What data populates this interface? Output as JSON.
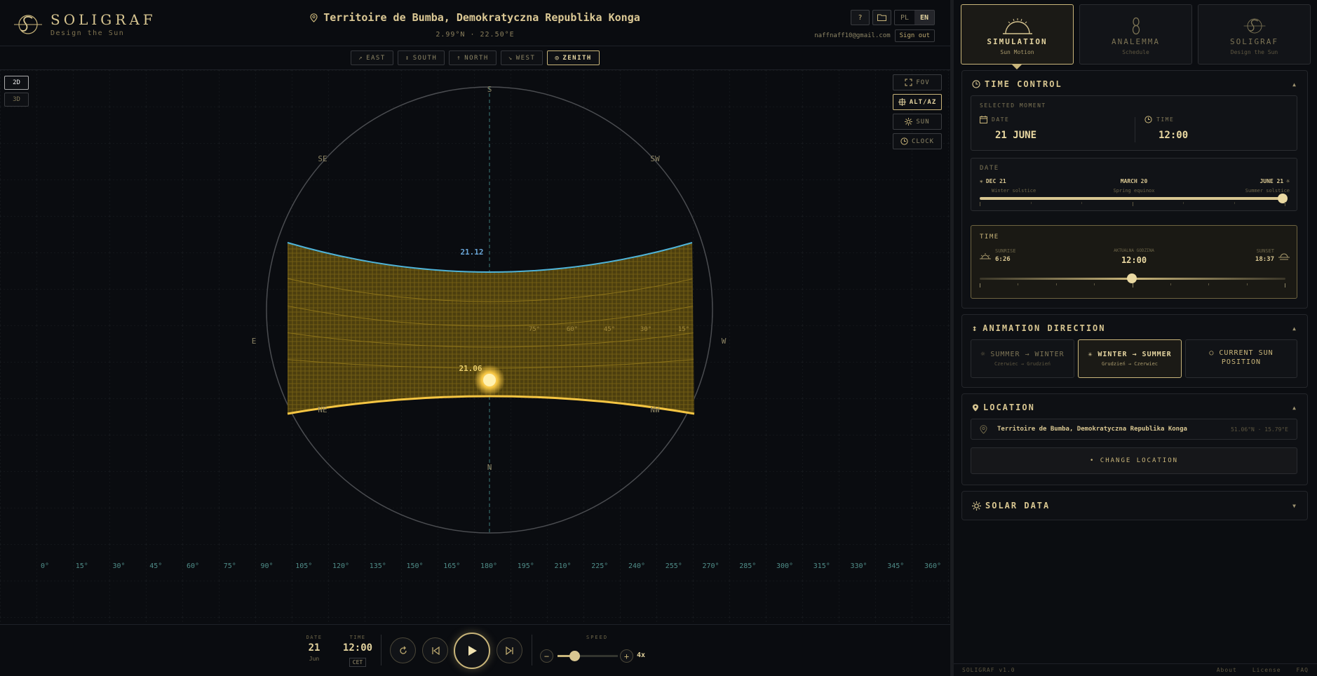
{
  "header": {
    "brand": "SOLIGRAF",
    "tagline": "Design the Sun",
    "location_title": "Territoire de Bumba, Demokratyczna Republika Konga",
    "location_coords": "2.99°N · 22.50°E",
    "help_label": "?",
    "lang_pl": "PL",
    "lang_en": "EN",
    "user_email": "naffnaff10@gmail.com",
    "signout_label": "Sign out"
  },
  "view_tabs": [
    {
      "label": "EAST",
      "glyph": "↗",
      "active": false
    },
    {
      "label": "SOUTH",
      "glyph": "↕",
      "active": false
    },
    {
      "label": "NORTH",
      "glyph": "↑",
      "active": false
    },
    {
      "label": "WEST",
      "glyph": "↘",
      "active": false
    },
    {
      "label": "ZENITH",
      "glyph": "◎",
      "active": true
    }
  ],
  "mode_buttons": {
    "d2": "2D",
    "d3": "3D"
  },
  "tools": {
    "fov": "FOV",
    "altaz": "ALT/AZ",
    "sun": "SUN",
    "clock": "CLOCK"
  },
  "compass": {
    "S": "S",
    "SE": "SE",
    "SW": "SW",
    "E": "E",
    "W": "W",
    "NE": "NE",
    "NW": "NW",
    "N": "N"
  },
  "plot_labels": {
    "upper_curve": "21.12",
    "lower_curve": "21.06",
    "alt_75": "75°",
    "alt_60": "60°",
    "alt_45": "45°",
    "alt_30": "30°",
    "alt_15": "15°"
  },
  "azimuth_ticks": [
    "0°",
    "15°",
    "30°",
    "45°",
    "60°",
    "75°",
    "90°",
    "105°",
    "120°",
    "135°",
    "150°",
    "165°",
    "180°",
    "195°",
    "210°",
    "225°",
    "240°",
    "255°",
    "270°",
    "285°",
    "300°",
    "315°",
    "330°",
    "345°",
    "360°"
  ],
  "playback": {
    "date_label": "DATE",
    "date_day": "21",
    "date_month": "Jun",
    "time_label": "TIME",
    "time_value": "12:00",
    "tz": "CET",
    "speed_label": "SPEED",
    "speed_value": "4x"
  },
  "panel_tabs": [
    {
      "title": "SIMULATION",
      "sub": "Sun Motion",
      "icon": "sunrise-icon",
      "active": true
    },
    {
      "title": "ANALEMMA",
      "sub": "Schedule",
      "icon": "figure-eight-icon",
      "active": false
    },
    {
      "title": "SOLIGRAF",
      "sub": "Design the Sun",
      "icon": "soligraf-logo-icon",
      "active": false
    }
  ],
  "time_control": {
    "heading": "TIME CONTROL",
    "selected_moment": "SELECTED MOMENT",
    "date_label": "DATE",
    "date_value": "21 JUNE",
    "time_label": "TIME",
    "time_value": "12:00",
    "date_slider": {
      "label": "DATE",
      "left_title": "DEC 21",
      "left_sub": "Winter solstice",
      "mid_title": "MARCH 20",
      "mid_sub": "Spring equinox",
      "right_title": "JUNE 21",
      "right_sub": "Summer solstice",
      "position": 1.0
    },
    "time_slider": {
      "label": "TIME",
      "sunrise_label": "SUNRISE",
      "sunrise": "6:26",
      "current_label": "AKTUALNA GODZINA",
      "current": "12:00",
      "sunset_label": "SUNSET",
      "sunset": "18:37",
      "position": 0.5
    }
  },
  "animation": {
    "heading": "ANIMATION DIRECTION",
    "opt1_title": "SUMMER → WINTER",
    "opt1_sub": "Czerwiec → Grudzień",
    "opt2_title": "WINTER → SUMMER",
    "opt2_sub": "Grudzień → Czerwiec",
    "opt3_title": "CURRENT SUN POSITION"
  },
  "location": {
    "heading": "LOCATION",
    "name": "Territoire de Bumba, Demokratyczna Republika Konga",
    "coords": "51.06°N · 15.79°E",
    "change_label": "• CHANGE LOCATION"
  },
  "solar": {
    "heading": "SOLAR DATA"
  },
  "footer": {
    "version": "SOLIGRAF v1.0",
    "about": "About",
    "license": "License",
    "faq": "FAQ"
  },
  "colors": {
    "accent": "#c9b57a",
    "sun": "#f5c542",
    "curve_blue": "#4fb3d8",
    "bg": "#0a0c10"
  }
}
